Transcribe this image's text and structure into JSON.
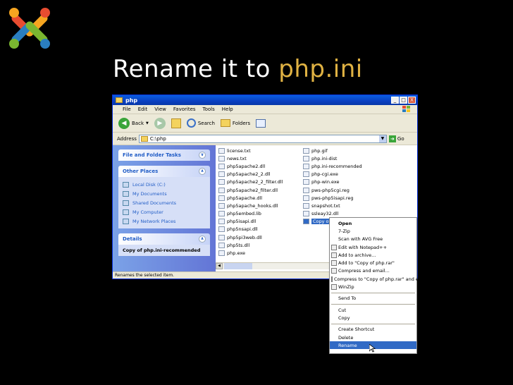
{
  "slide": {
    "title_prefix": "Rename it to ",
    "title_highlight": "php.ini"
  },
  "window": {
    "title": "php",
    "controls": [
      "_",
      "□",
      "X"
    ],
    "menu": [
      "File",
      "Edit",
      "View",
      "Favorites",
      "Tools",
      "Help"
    ],
    "toolbar": {
      "back": "Back",
      "search": "Search",
      "folders": "Folders"
    },
    "address": {
      "label": "Address",
      "value": "C:\\php",
      "go": "Go"
    },
    "statusbar": "Renames the selected item."
  },
  "taskpane": {
    "file_folder_tasks": "File and Folder Tasks",
    "other_places": "Other Places",
    "places": [
      "Local Disk (C:)",
      "My Documents",
      "Shared Documents",
      "My Computer",
      "My Network Places"
    ],
    "details": "Details",
    "details_name": "Copy of php.ini-recommended"
  },
  "files": {
    "col1": [
      "license.txt",
      "news.txt",
      "php5apache2.dll",
      "php5apache2_2.dll",
      "php5apache2_2_filter.dll",
      "php5apache2_filter.dll",
      "php5apache.dll",
      "php5apache_hooks.dll",
      "php5embed.lib",
      "php5isapi.dll",
      "php5nsapi.dll",
      "php5pi3web.dll",
      "php5ts.dll",
      "php.exe"
    ],
    "col2": [
      "php.gif",
      "php.ini-dist",
      "php.ini-recommended",
      "php-cgi.exe",
      "php-win.exe",
      "pws-php5cgi.reg",
      "pws-php5isapi.reg",
      "snapshot.txt",
      "ssleay32.dll",
      "Copy of php.ini-recommended"
    ]
  },
  "context_menu": {
    "items": [
      "Open",
      "7-Zip",
      "Scan with AVG Free",
      "Edit with Notepad++",
      "Add to archive...",
      "Add to \"Copy of php.rar\"",
      "Compress and email...",
      "Compress to \"Copy of php.rar\" and email",
      "WinZip",
      "Send To",
      "Cut",
      "Copy",
      "Create Shortcut",
      "Delete",
      "Rename"
    ]
  },
  "colors": {
    "accent": "#e0b243",
    "selection": "#316ac5",
    "taskpane": "#6375d6"
  }
}
